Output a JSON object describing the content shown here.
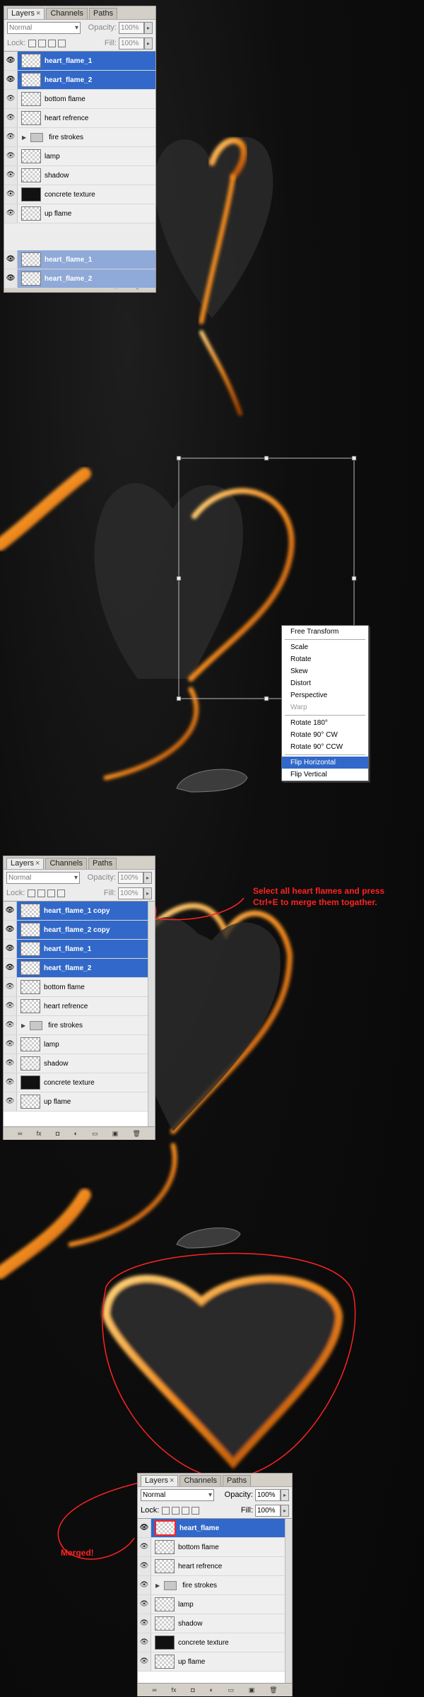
{
  "panel1": {
    "tabs": [
      "Layers",
      "Channels",
      "Paths"
    ],
    "close_glyph": "×",
    "blend_mode": "Normal",
    "opacity_label": "Opacity:",
    "opacity_value": "100%",
    "lock_label": "Lock:",
    "fill_label": "Fill:",
    "fill_value": "100%",
    "layers": [
      {
        "name": "heart_flame_1",
        "state": "selected"
      },
      {
        "name": "heart_flame_2",
        "state": "selected"
      },
      {
        "name": "bottom flame",
        "state": "normal"
      },
      {
        "name": "heart refrence",
        "state": "normal"
      },
      {
        "name": "fire strokes",
        "state": "folder"
      },
      {
        "name": "lamp",
        "state": "normal"
      },
      {
        "name": "shadow",
        "state": "normal"
      },
      {
        "name": "concrete texture",
        "state": "dark"
      },
      {
        "name": "up flame",
        "state": "normal"
      }
    ],
    "drag_layers": [
      "heart_flame_1",
      "heart_flame_2"
    ]
  },
  "context_menu": {
    "items": [
      {
        "label": "Free Transform",
        "state": "normal"
      },
      {
        "label": "sep"
      },
      {
        "label": "Scale",
        "state": "normal"
      },
      {
        "label": "Rotate",
        "state": "normal"
      },
      {
        "label": "Skew",
        "state": "normal"
      },
      {
        "label": "Distort",
        "state": "normal"
      },
      {
        "label": "Perspective",
        "state": "normal"
      },
      {
        "label": "Warp",
        "state": "disabled"
      },
      {
        "label": "sep"
      },
      {
        "label": "Rotate 180°",
        "state": "normal"
      },
      {
        "label": "Rotate 90° CW",
        "state": "normal"
      },
      {
        "label": "Rotate 90° CCW",
        "state": "normal"
      },
      {
        "label": "sep"
      },
      {
        "label": "Flip Horizontal",
        "state": "highlight"
      },
      {
        "label": "Flip Vertical",
        "state": "normal"
      }
    ]
  },
  "panel2": {
    "tabs": [
      "Layers",
      "Channels",
      "Paths"
    ],
    "blend_mode": "Normal",
    "opacity_label": "Opacity:",
    "opacity_value": "100%",
    "lock_label": "Lock:",
    "fill_label": "Fill:",
    "fill_value": "100%",
    "layers": [
      {
        "name": "heart_flame_1 copy",
        "state": "selected"
      },
      {
        "name": "heart_flame_2 copy",
        "state": "selected"
      },
      {
        "name": "heart_flame_1",
        "state": "selected"
      },
      {
        "name": "heart_flame_2",
        "state": "selected"
      },
      {
        "name": "bottom flame",
        "state": "normal"
      },
      {
        "name": "heart refrence",
        "state": "normal"
      },
      {
        "name": "fire strokes",
        "state": "folder"
      },
      {
        "name": "lamp",
        "state": "normal"
      },
      {
        "name": "shadow",
        "state": "normal"
      },
      {
        "name": "concrete texture",
        "state": "dark"
      },
      {
        "name": "up flame",
        "state": "normal"
      }
    ]
  },
  "annotation_merge": "Select all heart flames and press Ctrl+E to merge them togather.",
  "panel3": {
    "tabs": [
      "Layers",
      "Channels",
      "Paths"
    ],
    "blend_mode": "Normal",
    "opacity_label": "Opacity:",
    "opacity_value": "100%",
    "lock_label": "Lock:",
    "fill_label": "Fill:",
    "fill_value": "100%",
    "layers": [
      {
        "name": "heart_flame",
        "state": "selected"
      },
      {
        "name": "bottom flame",
        "state": "normal"
      },
      {
        "name": "heart refrence",
        "state": "normal"
      },
      {
        "name": "fire strokes",
        "state": "folder"
      },
      {
        "name": "lamp",
        "state": "normal"
      },
      {
        "name": "shadow",
        "state": "normal"
      },
      {
        "name": "concrete texture",
        "state": "dark"
      },
      {
        "name": "up flame",
        "state": "normal"
      }
    ]
  },
  "annotation_merged": "Merged!",
  "bottom_icons": [
    "link-icon",
    "fx-icon",
    "mask-icon",
    "adjustment-icon",
    "folder-icon",
    "new-layer-icon",
    "trash-icon"
  ],
  "colors": {
    "selection": "#3168c9",
    "flame": "#f08a1e",
    "annotation": "#ff2222"
  }
}
